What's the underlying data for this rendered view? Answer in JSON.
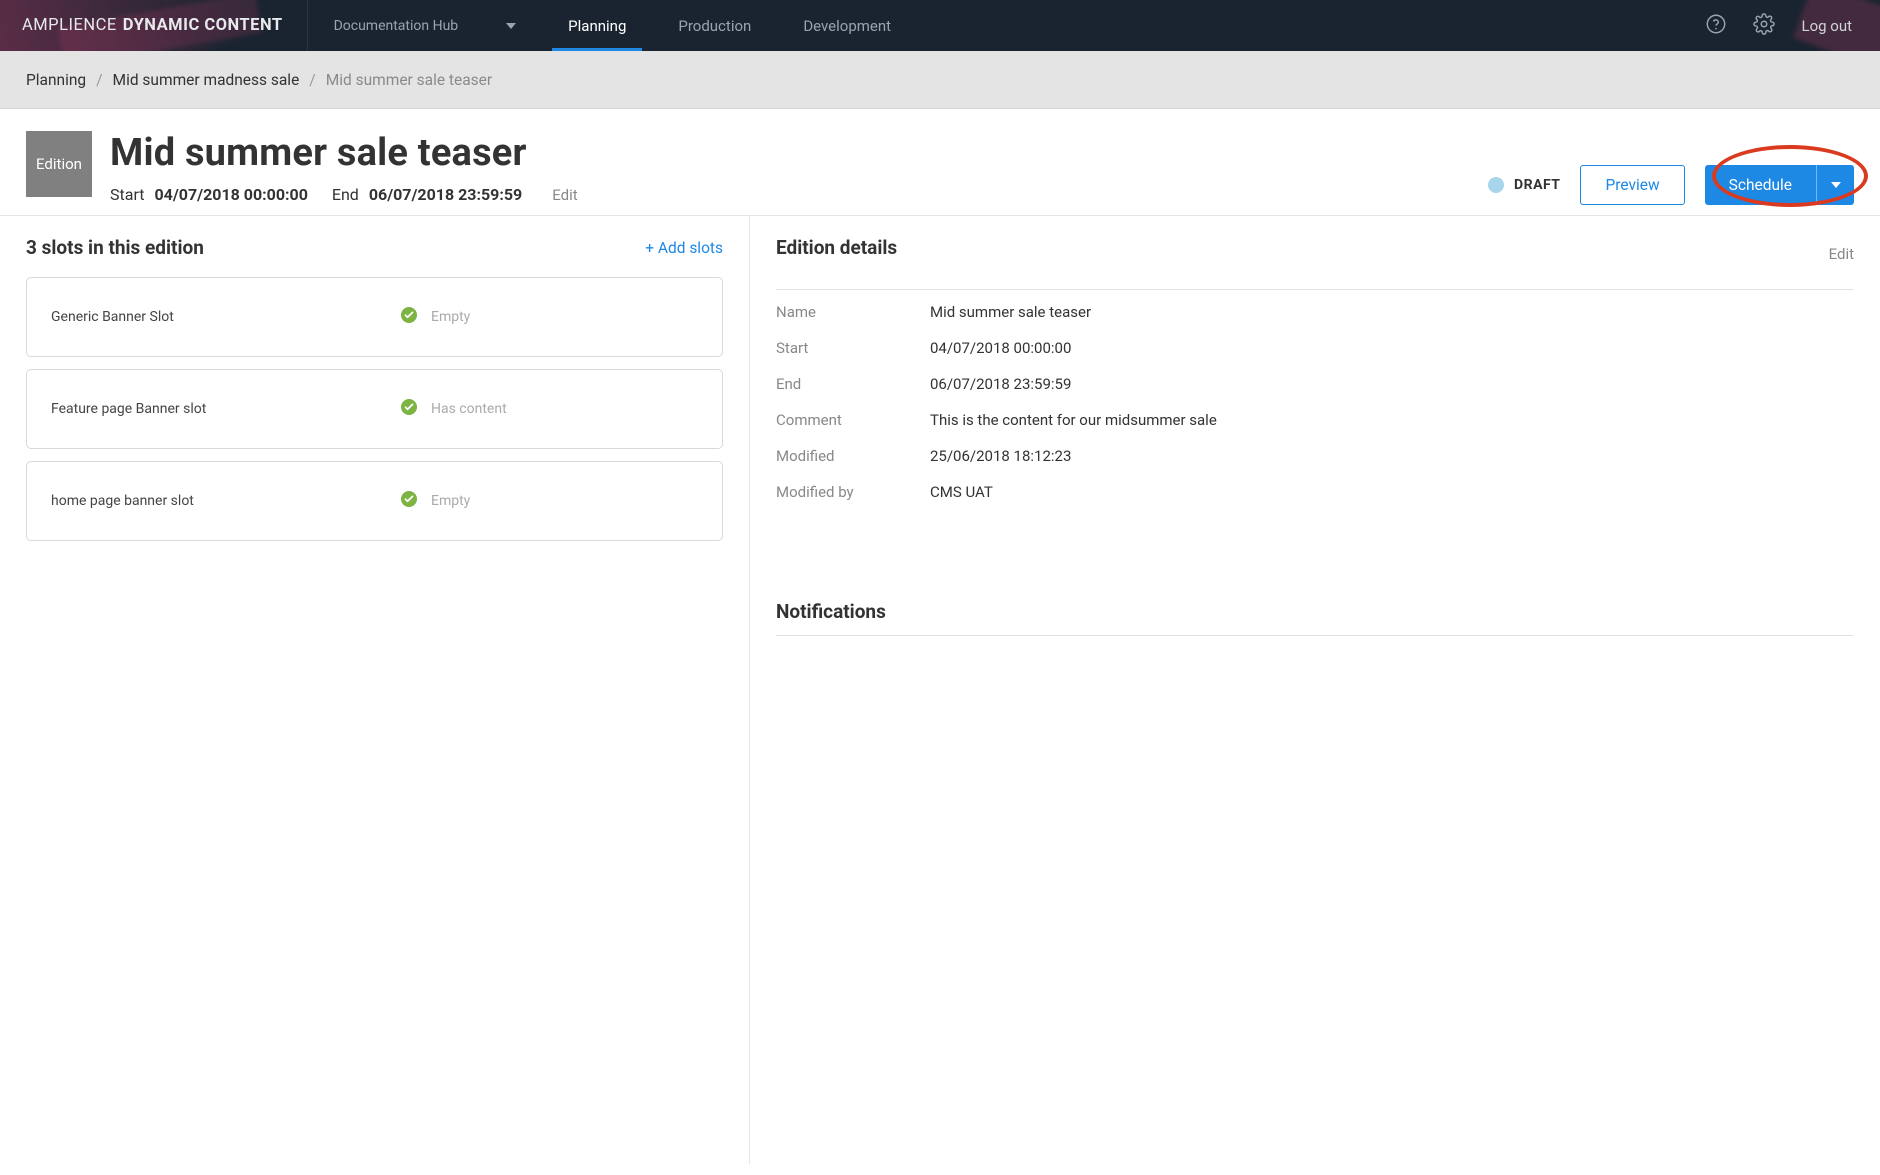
{
  "brand": {
    "part1": "AMPLIENCE",
    "part2": "DYNAMIC CONTENT"
  },
  "hub": {
    "label": "Documentation Hub"
  },
  "nav": {
    "tabs": [
      "Planning",
      "Production",
      "Development"
    ],
    "active": "Planning"
  },
  "top": {
    "logout": "Log out"
  },
  "breadcrumb": {
    "items": [
      "Planning",
      "Mid summer madness sale",
      "Mid summer sale teaser"
    ]
  },
  "header": {
    "badge": "Edition",
    "title": "Mid summer sale teaser",
    "start_label": "Start",
    "start_value": "04/07/2018 00:00:00",
    "end_label": "End",
    "end_value": "06/07/2018 23:59:59",
    "edit": "Edit",
    "status": "DRAFT",
    "preview": "Preview",
    "schedule": "Schedule"
  },
  "slots": {
    "heading": "3 slots in this edition",
    "add": "+ Add slots",
    "items": [
      {
        "name": "Generic Banner Slot",
        "status": "Empty"
      },
      {
        "name": "Feature page Banner slot",
        "status": "Has content"
      },
      {
        "name": "home page banner slot",
        "status": "Empty"
      }
    ]
  },
  "details": {
    "heading": "Edition details",
    "edit": "Edit",
    "rows": [
      {
        "k": "Name",
        "v": "Mid summer sale teaser"
      },
      {
        "k": "Start",
        "v": "04/07/2018 00:00:00"
      },
      {
        "k": "End",
        "v": "06/07/2018 23:59:59"
      },
      {
        "k": "Comment",
        "v": "This is the content for our midsummer sale"
      },
      {
        "k": "Modified",
        "v": "25/06/2018 18:12:23"
      },
      {
        "k": "Modified by",
        "v": "CMS UAT"
      }
    ]
  },
  "notifications": {
    "heading": "Notifications"
  }
}
